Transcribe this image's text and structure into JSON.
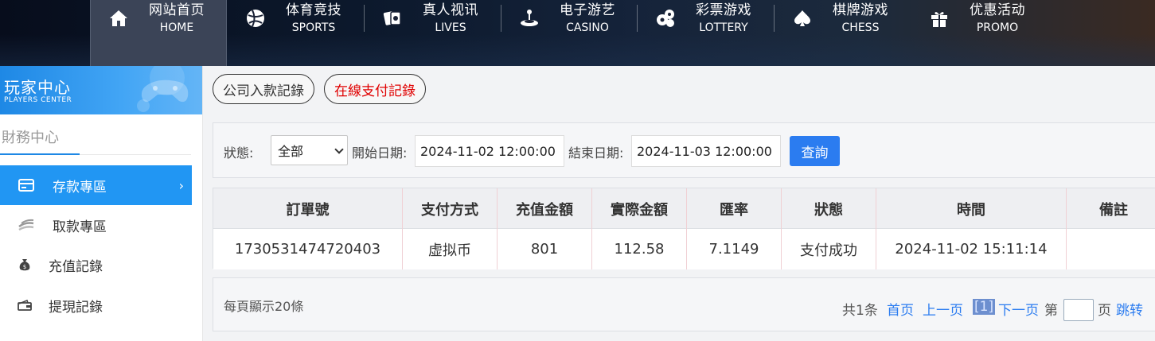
{
  "nav": {
    "items": [
      {
        "cn": "网站首页",
        "en": "HOME",
        "icon": "home-icon",
        "active": true
      },
      {
        "cn": "体育竞技",
        "en": "SPORTS",
        "icon": "ball-icon"
      },
      {
        "cn": "真人视讯",
        "en": "LIVES",
        "icon": "cards-icon"
      },
      {
        "cn": "电子游艺",
        "en": "CASINO",
        "icon": "joystick-icon"
      },
      {
        "cn": "彩票游戏",
        "en": "LOTTERY",
        "icon": "lottery-balls-icon"
      },
      {
        "cn": "棋牌游戏",
        "en": "CHESS",
        "icon": "spade-icon"
      },
      {
        "cn": "优惠活动",
        "en": "PROMO",
        "icon": "gift-icon"
      }
    ]
  },
  "sidebar": {
    "header_cn": "玩家中心",
    "header_en": "PLAYERS CENTER",
    "section_title": "財務中心",
    "items": [
      {
        "label": "存款專區",
        "icon": "card-icon",
        "active": true,
        "arrow": "›"
      },
      {
        "label": "取款專區",
        "icon": "cash-icon"
      },
      {
        "label": "充值記錄",
        "icon": "money-bag-icon"
      },
      {
        "label": "提現記錄",
        "icon": "wallet-icon"
      }
    ]
  },
  "tabs": {
    "company": "公司入款記錄",
    "online": "在線支付記錄"
  },
  "filter": {
    "status_label": "狀態:",
    "status_value": "全部",
    "start_label": "開始日期:",
    "start_value": "2024-11-02 12:00:00",
    "end_label": "結束日期:",
    "end_value": "2024-11-03 12:00:00",
    "query_button": "查詢"
  },
  "table": {
    "headers": [
      "訂單號",
      "支付方式",
      "充值金額",
      "實際金額",
      "匯率",
      "狀態",
      "時間",
      "備註"
    ],
    "rows": [
      [
        "1730531474720403",
        "虚拟币",
        "801",
        "112.58",
        "7.1149",
        "支付成功",
        "2024-11-02 15:11:14",
        ""
      ]
    ]
  },
  "pager": {
    "page_size_text": "每頁顯示20條",
    "total": "共1条",
    "first": "首页",
    "prev": "上一页",
    "current": "[1]",
    "next": "下一页",
    "page_prefix": "第",
    "page_suffix": "页",
    "jump": "跳转"
  },
  "colors": {
    "accent": "#2196f3",
    "button": "#2b7cf0",
    "red": "#e00000"
  }
}
